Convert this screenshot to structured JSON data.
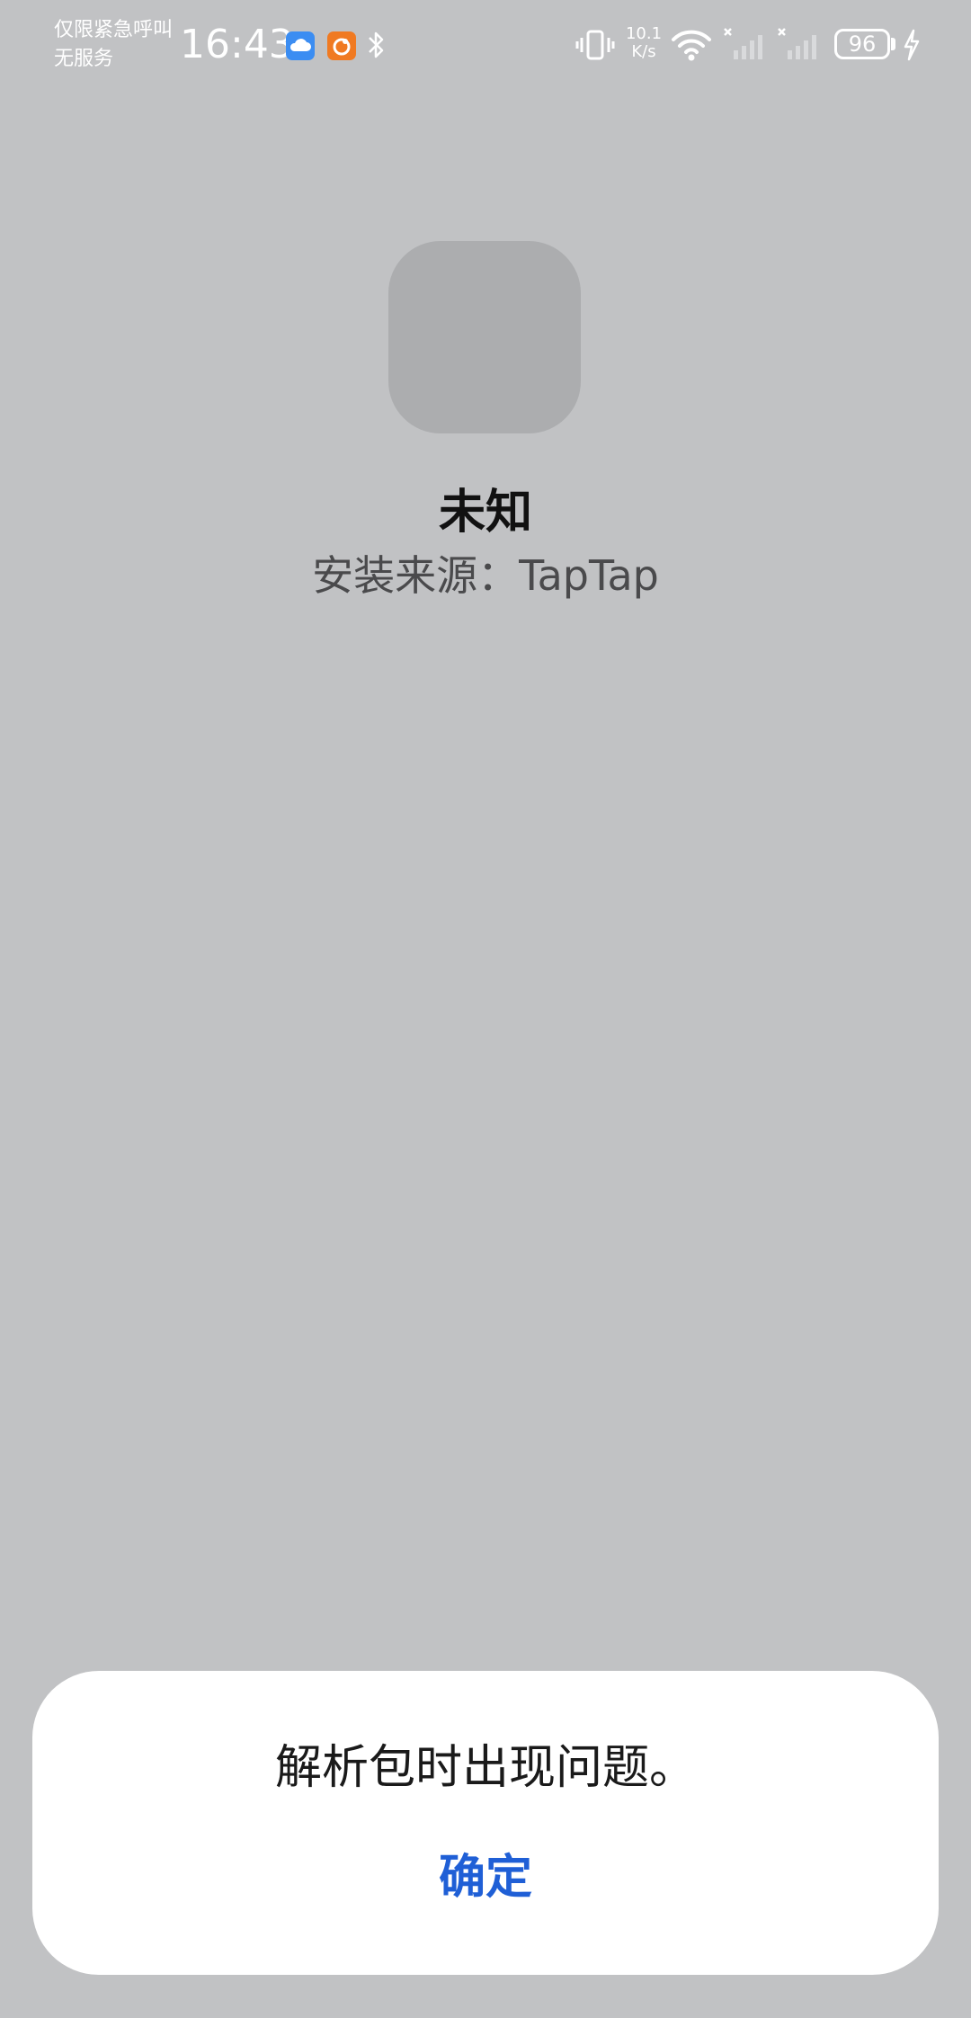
{
  "status_bar": {
    "carrier_line1": "仅限紧急呼叫",
    "carrier_line2": "无服务",
    "time": "16:43",
    "net_speed_value": "10.1",
    "net_speed_unit": "K/s",
    "battery_level": "96",
    "icons": [
      "cloud-notification-icon",
      "app-notification-icon",
      "bluetooth-icon",
      "vibrate-icon",
      "wifi-icon",
      "signal-icon",
      "signal-icon",
      "battery-icon",
      "charging-icon"
    ]
  },
  "app": {
    "name": "未知",
    "source": "安装来源：TapTap"
  },
  "dialog": {
    "message": "解析包时出现问题。",
    "confirm_label": "确定"
  },
  "colors": {
    "background": "#c1c2c4",
    "accent": "#1f5fd6",
    "dialog_bg": "#ffffff"
  }
}
